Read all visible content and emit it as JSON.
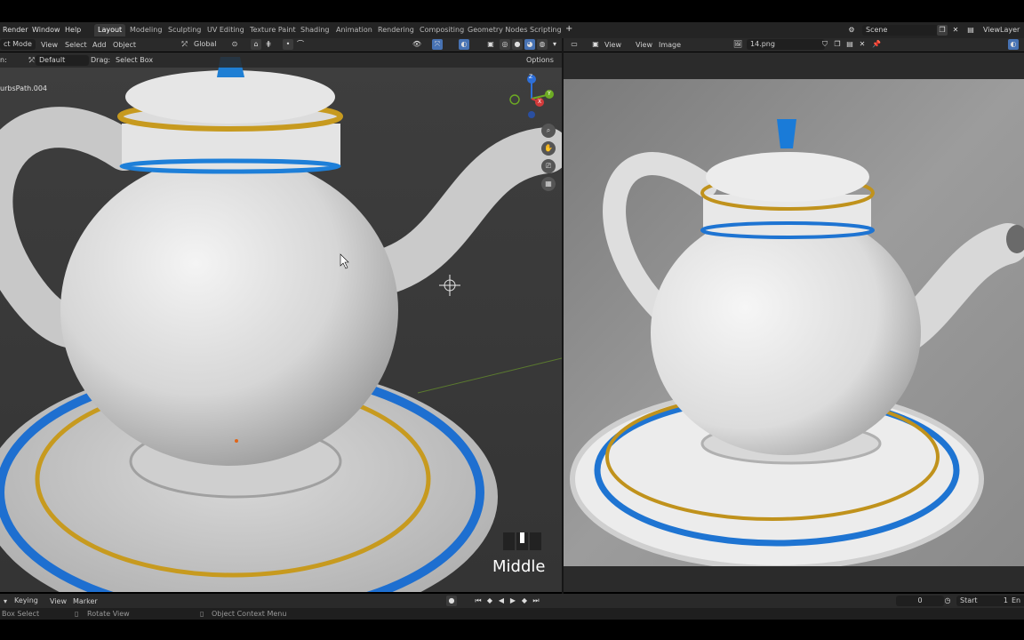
{
  "topbar": {
    "menus": [
      "Render",
      "Window",
      "Help"
    ],
    "workspaces": [
      "Layout",
      "Modeling",
      "Sculpting",
      "UV Editing",
      "Texture Paint",
      "Shading",
      "Animation",
      "Rendering",
      "Compositing",
      "Geometry Nodes",
      "Scripting"
    ],
    "active_workspace": "Layout",
    "add_tab": "+",
    "scene_label": "Scene",
    "viewlayer_label": "ViewLayer"
  },
  "viewport_header": {
    "mode": "ct Mode",
    "view": "View",
    "select": "Select",
    "add": "Add",
    "object": "Object",
    "orientation": "Global",
    "options": "Options"
  },
  "tool_header": {
    "orientation_label": "n:",
    "orientation_value": "Default",
    "drag_label": "Drag:",
    "drag_value": "Select Box"
  },
  "viewport_left": {
    "object_info": "urbsPath.004",
    "overlay_text": "Middle",
    "gizmo_axes": {
      "z": "Z",
      "y": "Y",
      "x": "X"
    }
  },
  "image_editor": {
    "view": "View",
    "view2": "View",
    "image": "Image",
    "image_name": "14.png"
  },
  "timeline": {
    "keying": "Keying",
    "view": "View",
    "marker": "Marker",
    "current_frame": "0",
    "start_label": "Start",
    "start_value": "1",
    "end_label": "En"
  },
  "statusbar": {
    "item1": "Box Select",
    "item2": "Rotate View",
    "item3": "Object Context Menu"
  },
  "colors": {
    "accent_blue": "#4772b3",
    "gold": "#c79a1f",
    "teapot_blue": "#1f7fd4"
  }
}
